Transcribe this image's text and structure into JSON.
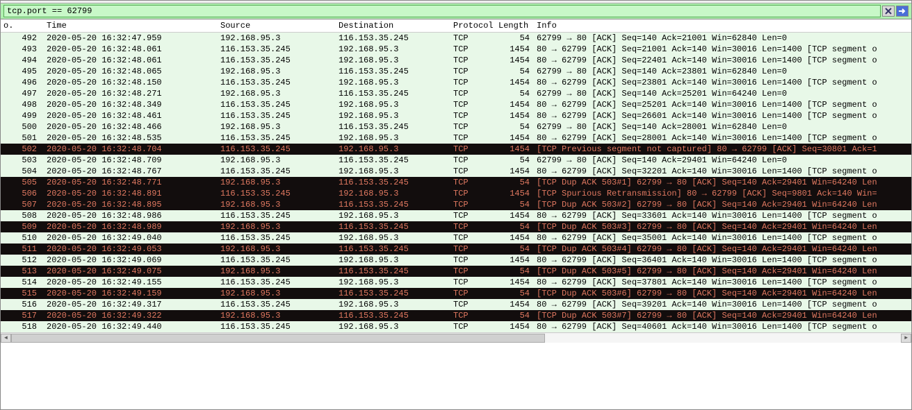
{
  "filter": {
    "value": "tcp.port == 62799"
  },
  "columns": {
    "no": "o.",
    "time": "Time",
    "source": "Source",
    "destination": "Destination",
    "protocol": "Protocol",
    "length": "Length",
    "info": "Info"
  },
  "ip_client": "192.168.95.3",
  "ip_server": "116.153.35.245",
  "packets": [
    {
      "no": "492",
      "time": "2020-05-20 16:32:47.959",
      "src": "192.168.95.3",
      "dst": "116.153.35.245",
      "proto": "TCP",
      "len": "54",
      "info": "62799 → 80 [ACK] Seq=140 Ack=21001 Win=62840 Len=0",
      "err": false
    },
    {
      "no": "493",
      "time": "2020-05-20 16:32:48.061",
      "src": "116.153.35.245",
      "dst": "192.168.95.3",
      "proto": "TCP",
      "len": "1454",
      "info": "80 → 62799 [ACK] Seq=21001 Ack=140 Win=30016 Len=1400 [TCP segment o",
      "err": false
    },
    {
      "no": "494",
      "time": "2020-05-20 16:32:48.061",
      "src": "116.153.35.245",
      "dst": "192.168.95.3",
      "proto": "TCP",
      "len": "1454",
      "info": "80 → 62799 [ACK] Seq=22401 Ack=140 Win=30016 Len=1400 [TCP segment o",
      "err": false
    },
    {
      "no": "495",
      "time": "2020-05-20 16:32:48.065",
      "src": "192.168.95.3",
      "dst": "116.153.35.245",
      "proto": "TCP",
      "len": "54",
      "info": "62799 → 80 [ACK] Seq=140 Ack=23801 Win=62840 Len=0",
      "err": false
    },
    {
      "no": "496",
      "time": "2020-05-20 16:32:48.150",
      "src": "116.153.35.245",
      "dst": "192.168.95.3",
      "proto": "TCP",
      "len": "1454",
      "info": "80 → 62799 [ACK] Seq=23801 Ack=140 Win=30016 Len=1400 [TCP segment o",
      "err": false
    },
    {
      "no": "497",
      "time": "2020-05-20 16:32:48.271",
      "src": "192.168.95.3",
      "dst": "116.153.35.245",
      "proto": "TCP",
      "len": "54",
      "info": "62799 → 80 [ACK] Seq=140 Ack=25201 Win=64240 Len=0",
      "err": false
    },
    {
      "no": "498",
      "time": "2020-05-20 16:32:48.349",
      "src": "116.153.35.245",
      "dst": "192.168.95.3",
      "proto": "TCP",
      "len": "1454",
      "info": "80 → 62799 [ACK] Seq=25201 Ack=140 Win=30016 Len=1400 [TCP segment o",
      "err": false
    },
    {
      "no": "499",
      "time": "2020-05-20 16:32:48.461",
      "src": "116.153.35.245",
      "dst": "192.168.95.3",
      "proto": "TCP",
      "len": "1454",
      "info": "80 → 62799 [ACK] Seq=26601 Ack=140 Win=30016 Len=1400 [TCP segment o",
      "err": false
    },
    {
      "no": "500",
      "time": "2020-05-20 16:32:48.466",
      "src": "192.168.95.3",
      "dst": "116.153.35.245",
      "proto": "TCP",
      "len": "54",
      "info": "62799 → 80 [ACK] Seq=140 Ack=28001 Win=62840 Len=0",
      "err": false
    },
    {
      "no": "501",
      "time": "2020-05-20 16:32:48.535",
      "src": "116.153.35.245",
      "dst": "192.168.95.3",
      "proto": "TCP",
      "len": "1454",
      "info": "80 → 62799 [ACK] Seq=28001 Ack=140 Win=30016 Len=1400 [TCP segment o",
      "err": false
    },
    {
      "no": "502",
      "time": "2020-05-20 16:32:48.704",
      "src": "116.153.35.245",
      "dst": "192.168.95.3",
      "proto": "TCP",
      "len": "1454",
      "info": "[TCP Previous segment not captured] 80 → 62799 [ACK] Seq=30801 Ack=1",
      "err": true
    },
    {
      "no": "503",
      "time": "2020-05-20 16:32:48.709",
      "src": "192.168.95.3",
      "dst": "116.153.35.245",
      "proto": "TCP",
      "len": "54",
      "info": "62799 → 80 [ACK] Seq=140 Ack=29401 Win=64240 Len=0",
      "err": false
    },
    {
      "no": "504",
      "time": "2020-05-20 16:32:48.767",
      "src": "116.153.35.245",
      "dst": "192.168.95.3",
      "proto": "TCP",
      "len": "1454",
      "info": "80 → 62799 [ACK] Seq=32201 Ack=140 Win=30016 Len=1400 [TCP segment o",
      "err": false
    },
    {
      "no": "505",
      "time": "2020-05-20 16:32:48.771",
      "src": "192.168.95.3",
      "dst": "116.153.35.245",
      "proto": "TCP",
      "len": "54",
      "info": "[TCP Dup ACK 503#1] 62799 → 80 [ACK] Seq=140 Ack=29401 Win=64240 Len",
      "err": true
    },
    {
      "no": "506",
      "time": "2020-05-20 16:32:48.891",
      "src": "116.153.35.245",
      "dst": "192.168.95.3",
      "proto": "TCP",
      "len": "1454",
      "info": "[TCP Spurious Retransmission] 80 → 62799 [ACK] Seq=9801 Ack=140 Win=",
      "err": true
    },
    {
      "no": "507",
      "time": "2020-05-20 16:32:48.895",
      "src": "192.168.95.3",
      "dst": "116.153.35.245",
      "proto": "TCP",
      "len": "54",
      "info": "[TCP Dup ACK 503#2] 62799 → 80 [ACK] Seq=140 Ack=29401 Win=64240 Len",
      "err": true
    },
    {
      "no": "508",
      "time": "2020-05-20 16:32:48.986",
      "src": "116.153.35.245",
      "dst": "192.168.95.3",
      "proto": "TCP",
      "len": "1454",
      "info": "80 → 62799 [ACK] Seq=33601 Ack=140 Win=30016 Len=1400 [TCP segment o",
      "err": false
    },
    {
      "no": "509",
      "time": "2020-05-20 16:32:48.989",
      "src": "192.168.95.3",
      "dst": "116.153.35.245",
      "proto": "TCP",
      "len": "54",
      "info": "[TCP Dup ACK 503#3] 62799 → 80 [ACK] Seq=140 Ack=29401 Win=64240 Len",
      "err": true
    },
    {
      "no": "510",
      "time": "2020-05-20 16:32:49.040",
      "src": "116.153.35.245",
      "dst": "192.168.95.3",
      "proto": "TCP",
      "len": "1454",
      "info": "80 → 62799 [ACK] Seq=35001 Ack=140 Win=30016 Len=1400 [TCP segment o",
      "err": false
    },
    {
      "no": "511",
      "time": "2020-05-20 16:32:49.053",
      "src": "192.168.95.3",
      "dst": "116.153.35.245",
      "proto": "TCP",
      "len": "54",
      "info": "[TCP Dup ACK 503#4] 62799 → 80 [ACK] Seq=140 Ack=29401 Win=64240 Len",
      "err": true
    },
    {
      "no": "512",
      "time": "2020-05-20 16:32:49.069",
      "src": "116.153.35.245",
      "dst": "192.168.95.3",
      "proto": "TCP",
      "len": "1454",
      "info": "80 → 62799 [ACK] Seq=36401 Ack=140 Win=30016 Len=1400 [TCP segment o",
      "err": false
    },
    {
      "no": "513",
      "time": "2020-05-20 16:32:49.075",
      "src": "192.168.95.3",
      "dst": "116.153.35.245",
      "proto": "TCP",
      "len": "54",
      "info": "[TCP Dup ACK 503#5] 62799 → 80 [ACK] Seq=140 Ack=29401 Win=64240 Len",
      "err": true
    },
    {
      "no": "514",
      "time": "2020-05-20 16:32:49.155",
      "src": "116.153.35.245",
      "dst": "192.168.95.3",
      "proto": "TCP",
      "len": "1454",
      "info": "80 → 62799 [ACK] Seq=37801 Ack=140 Win=30016 Len=1400 [TCP segment o",
      "err": false
    },
    {
      "no": "515",
      "time": "2020-05-20 16:32:49.159",
      "src": "192.168.95.3",
      "dst": "116.153.35.245",
      "proto": "TCP",
      "len": "54",
      "info": "[TCP Dup ACK 503#6] 62799 → 80 [ACK] Seq=140 Ack=29401 Win=64240 Len",
      "err": true
    },
    {
      "no": "516",
      "time": "2020-05-20 16:32:49.317",
      "src": "116.153.35.245",
      "dst": "192.168.95.3",
      "proto": "TCP",
      "len": "1454",
      "info": "80 → 62799 [ACK] Seq=39201 Ack=140 Win=30016 Len=1400 [TCP segment o",
      "err": false
    },
    {
      "no": "517",
      "time": "2020-05-20 16:32:49.322",
      "src": "192.168.95.3",
      "dst": "116.153.35.245",
      "proto": "TCP",
      "len": "54",
      "info": "[TCP Dup ACK 503#7] 62799 → 80 [ACK] Seq=140 Ack=29401 Win=64240 Len",
      "err": true
    },
    {
      "no": "518",
      "time": "2020-05-20 16:32:49.440",
      "src": "116.153.35.245",
      "dst": "192.168.95.3",
      "proto": "TCP",
      "len": "1454",
      "info": "80 → 62799 [ACK] Seq=40601 Ack=140 Win=30016 Len=1400 [TCP segment o",
      "err": false
    }
  ]
}
